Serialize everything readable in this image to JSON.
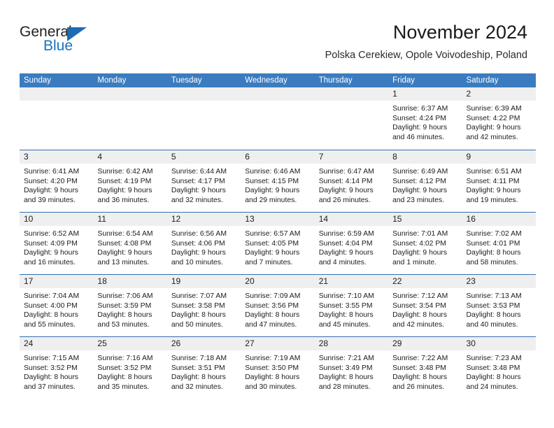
{
  "brand": {
    "name_part1": "General",
    "name_part2": "Blue",
    "triangle_color": "#1b6cb5",
    "blue_text_color": "#1773c4"
  },
  "header": {
    "title": "November 2024",
    "location": "Polska Cerekiew, Opole Voivodeship, Poland"
  },
  "theme": {
    "header_row_bg": "#3b7cc0",
    "week_separator": "#2f6fb3",
    "daynum_band_bg": "#efefef",
    "text_color": "#1c1c1c"
  },
  "weekday_headers": [
    "Sunday",
    "Monday",
    "Tuesday",
    "Wednesday",
    "Thursday",
    "Friday",
    "Saturday"
  ],
  "weeks": [
    [
      {
        "day": "",
        "empty": true
      },
      {
        "day": "",
        "empty": true
      },
      {
        "day": "",
        "empty": true
      },
      {
        "day": "",
        "empty": true
      },
      {
        "day": "",
        "empty": true
      },
      {
        "day": "1",
        "sunrise": "Sunrise: 6:37 AM",
        "sunset": "Sunset: 4:24 PM",
        "daylight1": "Daylight: 9 hours",
        "daylight2": "and 46 minutes."
      },
      {
        "day": "2",
        "sunrise": "Sunrise: 6:39 AM",
        "sunset": "Sunset: 4:22 PM",
        "daylight1": "Daylight: 9 hours",
        "daylight2": "and 42 minutes."
      }
    ],
    [
      {
        "day": "3",
        "sunrise": "Sunrise: 6:41 AM",
        "sunset": "Sunset: 4:20 PM",
        "daylight1": "Daylight: 9 hours",
        "daylight2": "and 39 minutes."
      },
      {
        "day": "4",
        "sunrise": "Sunrise: 6:42 AM",
        "sunset": "Sunset: 4:19 PM",
        "daylight1": "Daylight: 9 hours",
        "daylight2": "and 36 minutes."
      },
      {
        "day": "5",
        "sunrise": "Sunrise: 6:44 AM",
        "sunset": "Sunset: 4:17 PM",
        "daylight1": "Daylight: 9 hours",
        "daylight2": "and 32 minutes."
      },
      {
        "day": "6",
        "sunrise": "Sunrise: 6:46 AM",
        "sunset": "Sunset: 4:15 PM",
        "daylight1": "Daylight: 9 hours",
        "daylight2": "and 29 minutes."
      },
      {
        "day": "7",
        "sunrise": "Sunrise: 6:47 AM",
        "sunset": "Sunset: 4:14 PM",
        "daylight1": "Daylight: 9 hours",
        "daylight2": "and 26 minutes."
      },
      {
        "day": "8",
        "sunrise": "Sunrise: 6:49 AM",
        "sunset": "Sunset: 4:12 PM",
        "daylight1": "Daylight: 9 hours",
        "daylight2": "and 23 minutes."
      },
      {
        "day": "9",
        "sunrise": "Sunrise: 6:51 AM",
        "sunset": "Sunset: 4:11 PM",
        "daylight1": "Daylight: 9 hours",
        "daylight2": "and 19 minutes."
      }
    ],
    [
      {
        "day": "10",
        "sunrise": "Sunrise: 6:52 AM",
        "sunset": "Sunset: 4:09 PM",
        "daylight1": "Daylight: 9 hours",
        "daylight2": "and 16 minutes."
      },
      {
        "day": "11",
        "sunrise": "Sunrise: 6:54 AM",
        "sunset": "Sunset: 4:08 PM",
        "daylight1": "Daylight: 9 hours",
        "daylight2": "and 13 minutes."
      },
      {
        "day": "12",
        "sunrise": "Sunrise: 6:56 AM",
        "sunset": "Sunset: 4:06 PM",
        "daylight1": "Daylight: 9 hours",
        "daylight2": "and 10 minutes."
      },
      {
        "day": "13",
        "sunrise": "Sunrise: 6:57 AM",
        "sunset": "Sunset: 4:05 PM",
        "daylight1": "Daylight: 9 hours",
        "daylight2": "and 7 minutes."
      },
      {
        "day": "14",
        "sunrise": "Sunrise: 6:59 AM",
        "sunset": "Sunset: 4:04 PM",
        "daylight1": "Daylight: 9 hours",
        "daylight2": "and 4 minutes."
      },
      {
        "day": "15",
        "sunrise": "Sunrise: 7:01 AM",
        "sunset": "Sunset: 4:02 PM",
        "daylight1": "Daylight: 9 hours",
        "daylight2": "and 1 minute."
      },
      {
        "day": "16",
        "sunrise": "Sunrise: 7:02 AM",
        "sunset": "Sunset: 4:01 PM",
        "daylight1": "Daylight: 8 hours",
        "daylight2": "and 58 minutes."
      }
    ],
    [
      {
        "day": "17",
        "sunrise": "Sunrise: 7:04 AM",
        "sunset": "Sunset: 4:00 PM",
        "daylight1": "Daylight: 8 hours",
        "daylight2": "and 55 minutes."
      },
      {
        "day": "18",
        "sunrise": "Sunrise: 7:06 AM",
        "sunset": "Sunset: 3:59 PM",
        "daylight1": "Daylight: 8 hours",
        "daylight2": "and 53 minutes."
      },
      {
        "day": "19",
        "sunrise": "Sunrise: 7:07 AM",
        "sunset": "Sunset: 3:58 PM",
        "daylight1": "Daylight: 8 hours",
        "daylight2": "and 50 minutes."
      },
      {
        "day": "20",
        "sunrise": "Sunrise: 7:09 AM",
        "sunset": "Sunset: 3:56 PM",
        "daylight1": "Daylight: 8 hours",
        "daylight2": "and 47 minutes."
      },
      {
        "day": "21",
        "sunrise": "Sunrise: 7:10 AM",
        "sunset": "Sunset: 3:55 PM",
        "daylight1": "Daylight: 8 hours",
        "daylight2": "and 45 minutes."
      },
      {
        "day": "22",
        "sunrise": "Sunrise: 7:12 AM",
        "sunset": "Sunset: 3:54 PM",
        "daylight1": "Daylight: 8 hours",
        "daylight2": "and 42 minutes."
      },
      {
        "day": "23",
        "sunrise": "Sunrise: 7:13 AM",
        "sunset": "Sunset: 3:53 PM",
        "daylight1": "Daylight: 8 hours",
        "daylight2": "and 40 minutes."
      }
    ],
    [
      {
        "day": "24",
        "sunrise": "Sunrise: 7:15 AM",
        "sunset": "Sunset: 3:52 PM",
        "daylight1": "Daylight: 8 hours",
        "daylight2": "and 37 minutes."
      },
      {
        "day": "25",
        "sunrise": "Sunrise: 7:16 AM",
        "sunset": "Sunset: 3:52 PM",
        "daylight1": "Daylight: 8 hours",
        "daylight2": "and 35 minutes."
      },
      {
        "day": "26",
        "sunrise": "Sunrise: 7:18 AM",
        "sunset": "Sunset: 3:51 PM",
        "daylight1": "Daylight: 8 hours",
        "daylight2": "and 32 minutes."
      },
      {
        "day": "27",
        "sunrise": "Sunrise: 7:19 AM",
        "sunset": "Sunset: 3:50 PM",
        "daylight1": "Daylight: 8 hours",
        "daylight2": "and 30 minutes."
      },
      {
        "day": "28",
        "sunrise": "Sunrise: 7:21 AM",
        "sunset": "Sunset: 3:49 PM",
        "daylight1": "Daylight: 8 hours",
        "daylight2": "and 28 minutes."
      },
      {
        "day": "29",
        "sunrise": "Sunrise: 7:22 AM",
        "sunset": "Sunset: 3:48 PM",
        "daylight1": "Daylight: 8 hours",
        "daylight2": "and 26 minutes."
      },
      {
        "day": "30",
        "sunrise": "Sunrise: 7:23 AM",
        "sunset": "Sunset: 3:48 PM",
        "daylight1": "Daylight: 8 hours",
        "daylight2": "and 24 minutes."
      }
    ]
  ]
}
